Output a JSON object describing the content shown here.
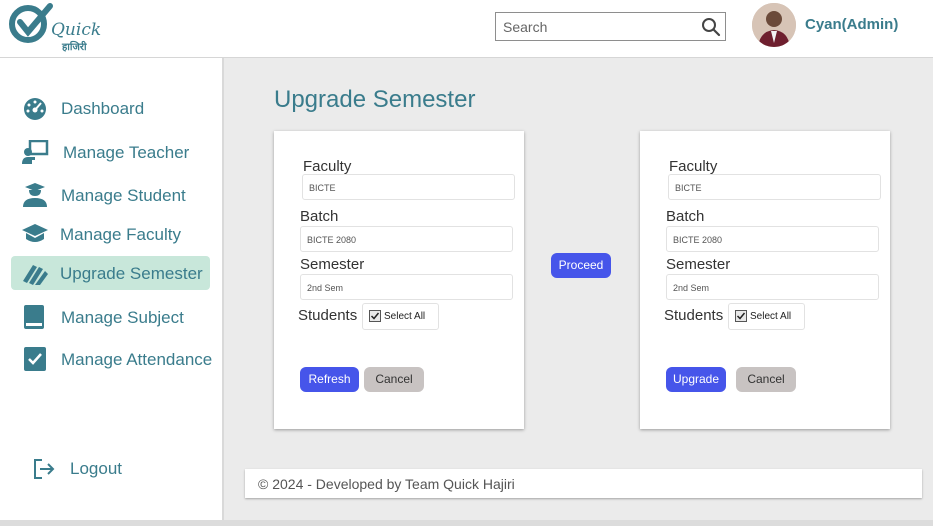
{
  "brand": {
    "logo_text": "Quick",
    "logo_subtext": "हाजिरी",
    "accent": "#3a7c8c"
  },
  "header": {
    "search_placeholder": "Search",
    "user_name": "Cyan(Admin)"
  },
  "sidebar": {
    "items": [
      {
        "label": "Dashboard",
        "icon": "dashboard-icon"
      },
      {
        "label": "Manage Teacher",
        "icon": "teacher-icon"
      },
      {
        "label": "Manage Student",
        "icon": "student-icon"
      },
      {
        "label": "Manage Faculty",
        "icon": "faculty-icon"
      },
      {
        "label": "Upgrade Semester",
        "icon": "upgrade-semester-icon",
        "active": true
      },
      {
        "label": "Manage Subject",
        "icon": "book-icon"
      },
      {
        "label": "Manage Attendance",
        "icon": "attendance-icon"
      }
    ],
    "logout_label": "Logout"
  },
  "main": {
    "title": "Upgrade Semester",
    "proceed_label": "Proceed",
    "source_card": {
      "faculty_label": "Faculty",
      "faculty_value": "BICTE",
      "batch_label": "Batch",
      "batch_value": "BICTE 2080",
      "semester_label": "Semester",
      "semester_value": "2nd Sem",
      "students_label": "Students",
      "select_all_label": "Select All",
      "primary_label": "Refresh",
      "cancel_label": "Cancel"
    },
    "target_card": {
      "faculty_label": "Faculty",
      "faculty_value": "BICTE",
      "batch_label": "Batch",
      "batch_value": "BICTE 2080",
      "semester_label": "Semester",
      "semester_value": "2nd Sem",
      "students_label": "Students",
      "select_all_label": "Select All",
      "primary_label": "Upgrade",
      "cancel_label": "Cancel"
    }
  },
  "footer": {
    "text": "© 2024 - Developed by Team Quick Hajiri"
  },
  "colors": {
    "primary_button": "#4655ea",
    "cancel_button": "#c8c3c2",
    "active_nav": "#c8e7da"
  }
}
